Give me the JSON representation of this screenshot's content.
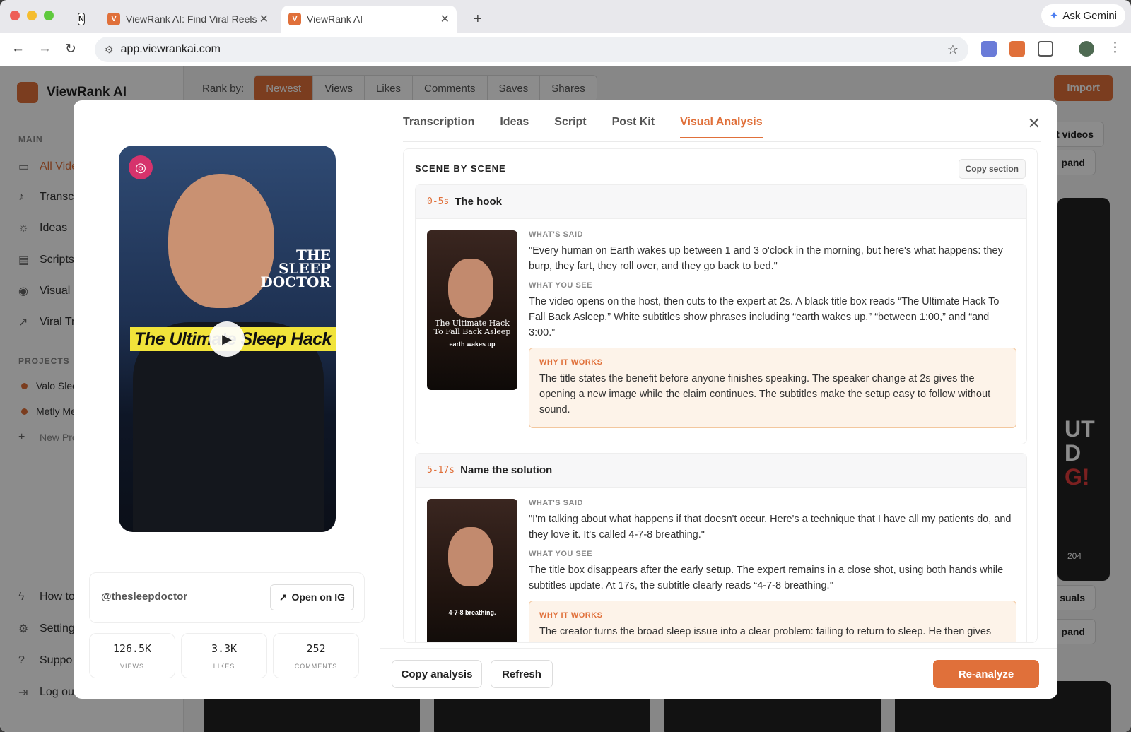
{
  "browser": {
    "tabs": [
      {
        "label": "ViewRank AI: Find Viral Reels"
      },
      {
        "label": "ViewRank AI"
      }
    ],
    "new_tab": "+",
    "ask_gemini": "Ask Gemini",
    "url": "app.viewrankai.com"
  },
  "app": {
    "brand": "ViewRank AI",
    "rank_by_label": "Rank by:",
    "rank_options": [
      "Newest",
      "Views",
      "Likes",
      "Comments",
      "Saves",
      "Shares"
    ],
    "import_label": "Import",
    "sidebar": {
      "main_heading": "MAIN",
      "main_items": [
        "All Vide",
        "Transc",
        "Ideas",
        "Scripts",
        "Visual",
        "Viral Tr"
      ],
      "projects_heading": "PROJECTS",
      "projects": [
        "Valo Slee",
        "Metly Me"
      ],
      "new_project": "New Pro",
      "bottom_items": [
        "How to",
        "Setting",
        "Suppo",
        "Log out"
      ]
    },
    "background_peek": {
      "select_videos": "ect videos",
      "expand_1": "pand",
      "visuals": "suals",
      "expand_2": "pand",
      "comment_count": "204",
      "overlay_text": [
        "UT",
        "D",
        "G!"
      ]
    }
  },
  "modal": {
    "video": {
      "title_overlay": "THE SLEEP DOCTOR",
      "banner_text": "The Ultimate Sleep Hack",
      "handle": "@thesleepdoctor",
      "open_ig": "Open on IG",
      "stats": [
        {
          "value": "126.5K",
          "label": "VIEWS"
        },
        {
          "value": "3.3K",
          "label": "LIKES"
        },
        {
          "value": "252",
          "label": "COMMENTS"
        }
      ]
    },
    "tabs": [
      "Transcription",
      "Ideas",
      "Script",
      "Post Kit",
      "Visual Analysis"
    ],
    "active_tab": "Visual Analysis",
    "section_title": "SCENE BY SCENE",
    "copy_section": "Copy section",
    "scenes": [
      {
        "time": "0-5s",
        "title": "The hook",
        "thumb_text": "The Ultimate Hack To Fall Back Asleep",
        "thumb_sub": "earth wakes up",
        "said_label": "WHAT'S SAID",
        "said": "\"Every human on Earth wakes up between 1 and 3 o'clock in the morning, but here's what happens: they burp, they fart, they roll over, and they go back to bed.\"",
        "see_label": "WHAT YOU SEE",
        "see": "The video opens on the host, then cuts to the expert at 2s. A black title box reads “The Ultimate Hack To Fall Back Asleep.” White subtitles show phrases including “earth wakes up,” “between 1:00,” and “and 3:00.”",
        "why_label": "WHY IT WORKS",
        "why": "The title states the benefit before anyone finishes speaking. The speaker change at 2s gives the opening a new image while the claim continues. The subtitles make the setup easy to follow without sound."
      },
      {
        "time": "5-17s",
        "title": "Name the solution",
        "thumb_text": "",
        "thumb_sub": "4-7-8 breathing.",
        "said_label": "WHAT'S SAID",
        "said": "\"I'm talking about what happens if that doesn't occur. Here's a technique that I have all my patients do, and they love it. It's called 4-7-8 breathing.\"",
        "see_label": "WHAT YOU SEE",
        "see": "The title box disappears after the early setup. The expert remains in a close shot, using both hands while subtitles update. At 17s, the subtitle clearly reads “4-7-8 breathing.”",
        "why_label": "WHY IT WORKS",
        "why": "The creator turns the broad sleep issue into a clear problem: failing to return to sleep. He then gives"
      }
    ],
    "footer": {
      "copy_analysis": "Copy analysis",
      "refresh": "Refresh",
      "reanalyze": "Re-analyze"
    }
  },
  "colors": {
    "accent": "#e0703a",
    "why_bg": "#fdf3e9",
    "why_border": "#f3c79e"
  }
}
